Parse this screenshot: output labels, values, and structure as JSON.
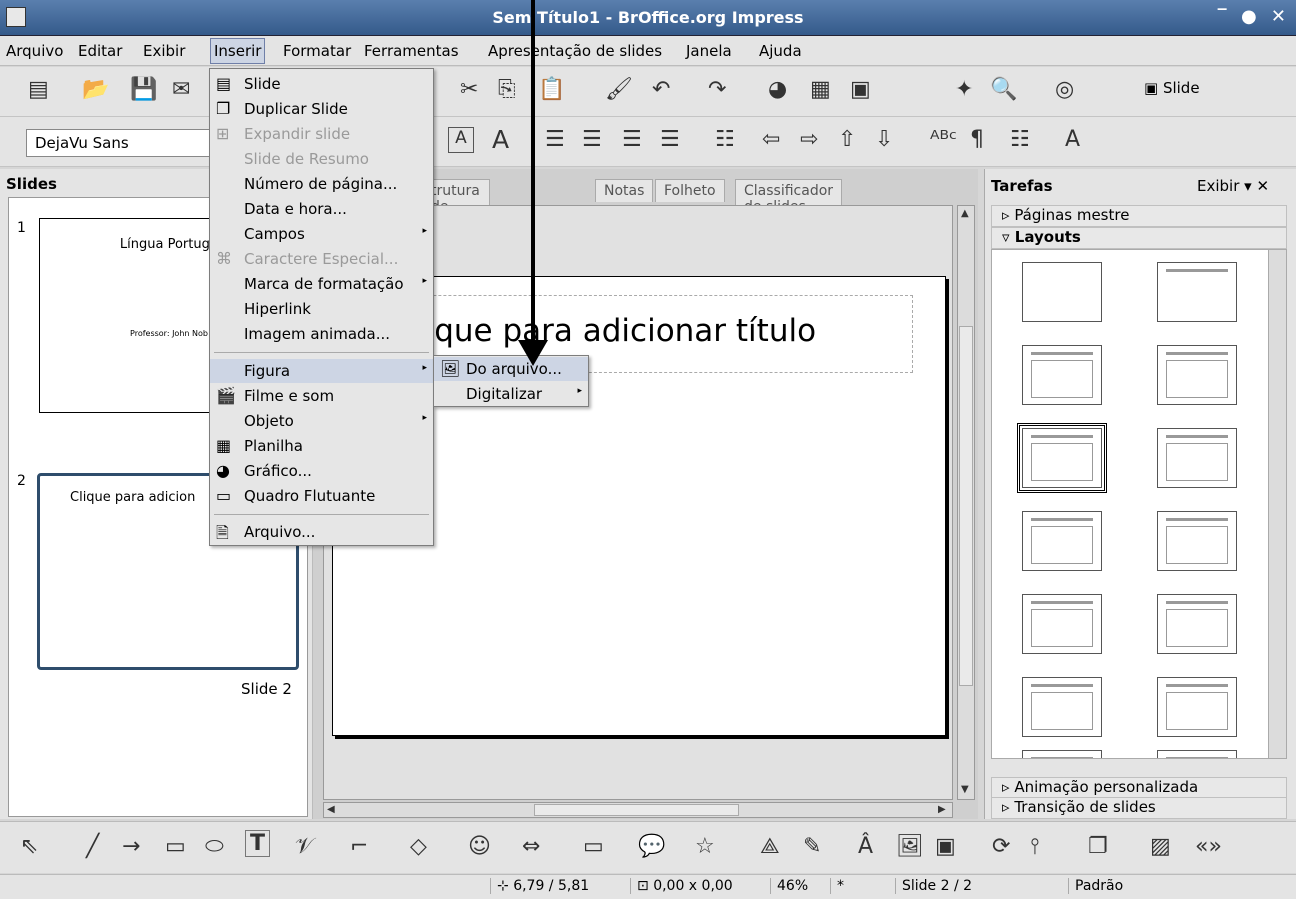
{
  "window": {
    "title": "Sem Título1 - BrOffice.org Impress"
  },
  "menubar": [
    "Arquivo",
    "Editar",
    "Exibir",
    "Inserir",
    "Formatar",
    "Ferramentas",
    "Apresentação de slides",
    "Janela",
    "Ajuda"
  ],
  "toolbar": {
    "font_name": "DejaVu Sans",
    "slide_button": "Slide"
  },
  "slides_pane": {
    "header": "Slides",
    "slides": [
      {
        "number": "1",
        "title": "Língua Portugu",
        "subtitle": "Professor: John Nob"
      },
      {
        "number": "2",
        "title": "Clique para adicion",
        "caption": "Slide 2"
      }
    ]
  },
  "tabs": [
    "trutura de tópicos",
    "Notas",
    "Folheto",
    "Classificador de slides"
  ],
  "slide_canvas": {
    "title_placeholder": "lique para adicionar título"
  },
  "insert_menu": {
    "items": [
      {
        "label": "Slide",
        "icon": "slide-icon"
      },
      {
        "label": "Duplicar Slide",
        "icon": "duplicate-icon"
      },
      {
        "label": "Expandir slide",
        "icon": "expand-icon",
        "disabled": true
      },
      {
        "label": "Slide de Resumo",
        "disabled": true
      },
      {
        "label": "Número de página..."
      },
      {
        "label": "Data e hora..."
      },
      {
        "label": "Campos",
        "submenu": true
      },
      {
        "label": "Caractere Especial...",
        "icon": "special-char-icon",
        "disabled": true
      },
      {
        "label": "Marca de formatação",
        "submenu": true
      },
      {
        "label": "Hiperlink"
      },
      {
        "label": "Imagem animada..."
      },
      {
        "label": "Figura",
        "submenu": true,
        "highlighted": true
      },
      {
        "label": "Filme e som",
        "icon": "movie-icon"
      },
      {
        "label": "Objeto",
        "submenu": true
      },
      {
        "label": "Planilha",
        "icon": "spreadsheet-icon"
      },
      {
        "label": "Gráfico...",
        "icon": "chart-icon"
      },
      {
        "label": "Quadro Flutuante",
        "icon": "frame-icon"
      },
      {
        "label": "Arquivo...",
        "icon": "file-icon"
      }
    ]
  },
  "figure_submenu": [
    "Do arquivo...",
    "Digitalizar"
  ],
  "tasks_pane": {
    "header": "Tarefas",
    "view_menu": "Exibir",
    "sections": [
      "Páginas mestre",
      "Layouts",
      "Animação personalizada",
      "Transição de slides"
    ]
  },
  "statusbar": {
    "position": "6,79 / 5,81",
    "size": "0,00 x 0,00",
    "zoom": "46%",
    "modified": "*",
    "slide": "Slide 2 / 2",
    "layout": "Padrão"
  },
  "colors": {
    "titlebar": "#345a8a",
    "menu_highlight": "#cdd5e4"
  }
}
